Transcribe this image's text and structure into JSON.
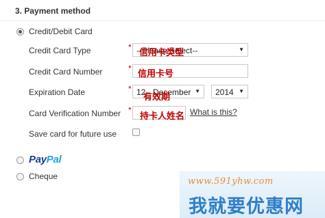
{
  "section": {
    "title": "3. Payment method"
  },
  "payment_options": {
    "card": {
      "label": "Credit/Debit Card",
      "selected": true
    },
    "paypal": {
      "pay": "Pay",
      "pal": "Pal",
      "selected": false
    },
    "cheque": {
      "label": "Cheque",
      "selected": false
    }
  },
  "form": {
    "required_mark": "*",
    "card_type": {
      "label": "Credit Card Type",
      "selected_value": "--Please Select--",
      "overlay_cn": "信用卡类型"
    },
    "card_number": {
      "label": "Credit Card Number",
      "value": "",
      "overlay_cn": "信用卡号"
    },
    "expiration": {
      "label": "Expiration Date",
      "month_value": "12 - December",
      "year_value": "2014",
      "overlay_cn": "有效期"
    },
    "cvn": {
      "label": "Card Verification Number",
      "value": "",
      "overlay_cn": "持卡人姓名",
      "help_link": "What is this?"
    },
    "save_card": {
      "label": "Save card for future use",
      "checked": false
    }
  },
  "watermark": {
    "url": "www.591yhw.com",
    "text_cn": "我就要优惠网"
  },
  "colors": {
    "required": "#cc0000",
    "overlay": "#c00000",
    "paypal_dark": "#1b3c8c",
    "paypal_light": "#1fa3e0",
    "watermark_blue": "#2f7fc8",
    "watermark_orange": "#e58c3a"
  },
  "icons": {
    "select_arrow": "chevron-down-icon",
    "radio": "radio-icon"
  }
}
